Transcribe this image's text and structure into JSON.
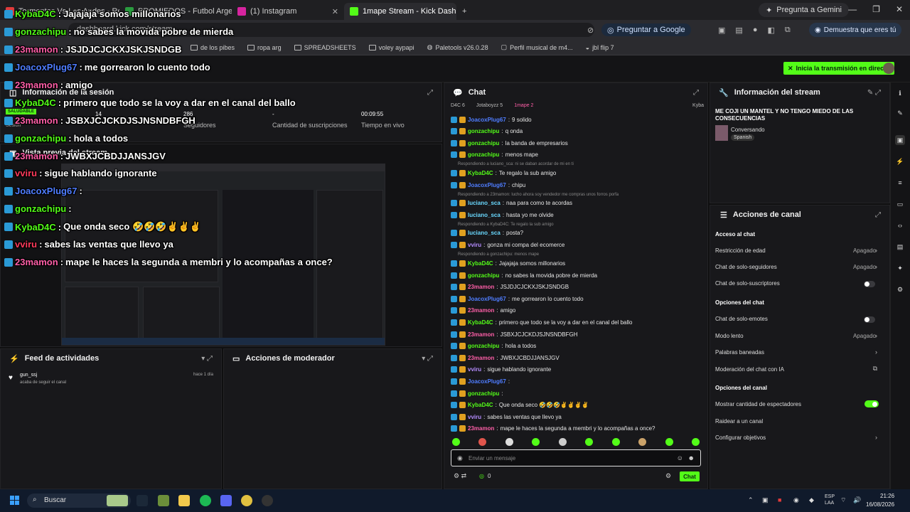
{
  "browser": {
    "tabs": [
      {
        "label": "Tormentas Vs Los Andes - Re...",
        "color": "#e23b3b"
      },
      {
        "label": "PROMIEDOS - Futbol Argentino",
        "color": "#2a9c3f"
      },
      {
        "label": "(1) Instagram",
        "color": "#d6249f"
      },
      {
        "label": "1mape Stream - Kick Dashboard",
        "color": "#53fc18"
      }
    ],
    "new_tab": "+",
    "gemini_label": "Pregunta a Gemini",
    "url": "dashboard.kick.com/stream",
    "google_btn": "Preguntar a Google",
    "proof_btn": "Demuestra que eres tú",
    "bookmarks": [
      "de los pibes",
      "ropa arg",
      "SPREADSHEETS",
      "voley aypapi",
      "Paletools v26.0.28",
      "Perfil musical de m4...",
      "jbl flip 7"
    ]
  },
  "dashboard": {
    "go_live": "Inicia la transmisión en directo",
    "session": {
      "title": "Información de la sesión",
      "tag": "SALUDABLE",
      "tag_sub": "Sesión",
      "stats": [
        {
          "value": "14",
          "label": ""
        },
        {
          "value": "286",
          "label": "Seguidores"
        },
        {
          "value": "-",
          "label": "Cantidad de suscripciones"
        },
        {
          "value": "00:09:55",
          "label": "Tiempo en vivo"
        }
      ]
    },
    "preview_title": "Vista previa del stream",
    "activity": {
      "title": "Feed de actividades",
      "user": "gun_ssj",
      "action": "acaba de seguir el canal",
      "time": "hace 1 día"
    },
    "moderator": {
      "title": "Acciones de moderador"
    },
    "chat": {
      "title": "Chat",
      "top_bar": [
        "D4C 6",
        "Jotaboyzz 5",
        "1mape 2",
        "Kyba"
      ],
      "messages": [
        {
          "user": "JoacoxPlug67",
          "text": "9 solido",
          "color": "#4f7dff"
        },
        {
          "user": "gonzachipu",
          "text": "q onda",
          "color": "#53fc18"
        },
        {
          "user": "gonzachipu",
          "text": "la banda de empresarios",
          "color": "#53fc18"
        },
        {
          "user": "gonzachipu",
          "text": "menos mape",
          "color": "#53fc18"
        },
        {
          "user": "KybaD4C",
          "text": "Te regalo la sub amigo",
          "color": "#53fc18",
          "reply": "Respondiendo a luciano_sca: ni se daban acordar de mi en ti"
        },
        {
          "user": "JoacoxPlug67",
          "text": "chipu",
          "color": "#4f7dff"
        },
        {
          "user": "luciano_sca",
          "text": "naa para como te acordas",
          "color": "#6ad9ff",
          "reply": "Respondiendo a 23mamon: lucho ahora soy vendedor me compras unos forros porfa"
        },
        {
          "user": "luciano_sca",
          "text": "hasta yo me olvide",
          "color": "#6ad9ff"
        },
        {
          "user": "luciano_sca",
          "text": "posta?",
          "color": "#6ad9ff",
          "reply": "Respondiendo a KybaD4C: Te regalo la sub amigo"
        },
        {
          "user": "vviru",
          "text": "gonza mi compa del ecomerce",
          "color": "#b58cff"
        },
        {
          "user": "KybaD4C",
          "text": "Jajajaja somos millonarios",
          "color": "#53fc18",
          "reply": "Respondiendo a gonzachipu: menos mape"
        },
        {
          "user": "gonzachipu",
          "text": "no sabes la movida pobre de mierda",
          "color": "#53fc18"
        },
        {
          "user": "23mamon",
          "text": "JSJDJCJCKXJSKJSNDGB",
          "color": "#ff5fa8"
        },
        {
          "user": "JoacoxPlug67",
          "text": "me gorrearon lo cuento todo",
          "color": "#4f7dff"
        },
        {
          "user": "23mamon",
          "text": "amigo",
          "color": "#ff5fa8"
        },
        {
          "user": "KybaD4C",
          "text": "primero que todo se la voy a dar en el canal del ballo",
          "color": "#53fc18"
        },
        {
          "user": "23mamon",
          "text": "JSBXJCJCKDJSJNSNDBFGH",
          "color": "#ff5fa8"
        },
        {
          "user": "gonzachipu",
          "text": "hola a todos",
          "color": "#53fc18"
        },
        {
          "user": "23mamon",
          "text": "JWBXJCBDJJANSJGV",
          "color": "#ff5fa8"
        },
        {
          "user": "vviru",
          "text": "sigue hablando ignorante",
          "color": "#b58cff"
        },
        {
          "user": "JoacoxPlug67",
          "text": "",
          "color": "#4f7dff"
        },
        {
          "user": "gonzachipu",
          "text": "",
          "color": "#53fc18"
        },
        {
          "user": "KybaD4C",
          "text": "Que onda seco 🤣🤣🤣✌✌✌✌",
          "color": "#53fc18"
        },
        {
          "user": "vviru",
          "text": "sabes las ventas que llevo ya",
          "color": "#b58cff"
        },
        {
          "user": "23mamon",
          "text": "mape le haces la segunda a membri y lo acompañas a once?",
          "color": "#ff5fa8"
        }
      ],
      "input_placeholder": "Enviar un mensaje",
      "points": "0",
      "send_label": "Chat"
    },
    "stream_info": {
      "title": "Información del stream",
      "stream_title": "ME COJI UN MANTEL Y NO TENGO MIEDO DE LAS CONSECUENCIAS",
      "category": "Conversando",
      "language": "Spanish"
    },
    "channel_actions": {
      "title": "Acciones de canal",
      "sections": [
        {
          "heading": "Acceso al chat",
          "items": [
            {
              "label": "Restricción de edad",
              "value": "Apagado",
              "kind": "chevron"
            },
            {
              "label": "Chat de solo-seguidores",
              "value": "Apagado",
              "kind": "chevron"
            },
            {
              "label": "Chat de solo-suscriptores",
              "value": "",
              "kind": "toggle-off"
            }
          ]
        },
        {
          "heading": "Opciones del chat",
          "items": [
            {
              "label": "Chat de solo-emotes",
              "value": "",
              "kind": "toggle-off"
            },
            {
              "label": "Modo lento",
              "value": "Apagado",
              "kind": "chevron"
            },
            {
              "label": "Palabras baneadas",
              "value": "",
              "kind": "chevron"
            },
            {
              "label": "Moderación del chat con IA",
              "value": "",
              "kind": "external"
            }
          ]
        },
        {
          "heading": "Opciones del canal",
          "items": [
            {
              "label": "Mostrar cantidad de espectadores",
              "value": "",
              "kind": "toggle-on"
            },
            {
              "label": "Raidear a un canal",
              "value": "",
              "kind": "none"
            },
            {
              "label": "Configurar objetivos",
              "value": "",
              "kind": "chevron"
            }
          ]
        }
      ]
    }
  },
  "overlay_chat": [
    {
      "user": "KybaD4C",
      "text": "Jajajaja somos millonarios",
      "color": "#53fc18"
    },
    {
      "user": "gonzachipu",
      "text": "no sabes la movida pobre de mierda",
      "color": "#53fc18"
    },
    {
      "user": "23mamon",
      "text": "JSJDJCJCKXJSKJSNDGB",
      "color": "#ff5fa8"
    },
    {
      "user": "JoacoxPlug67",
      "text": "me gorrearon lo cuento todo",
      "color": "#4f7dff"
    },
    {
      "user": "23mamon",
      "text": "amigo",
      "color": "#ff5fa8"
    },
    {
      "user": "KybaD4C",
      "text": "primero que todo se la voy a dar en el canal del ballo",
      "color": "#53fc18"
    },
    {
      "user": "23mamon",
      "text": "JSBXJCJCKDJSJNSNDBFGH",
      "color": "#ff5fa8"
    },
    {
      "user": "gonzachipu",
      "text": "hola a todos",
      "color": "#53fc18"
    },
    {
      "user": "23mamon",
      "text": "JWBXJCBDJJANSJGV",
      "color": "#ff5fa8"
    },
    {
      "user": "vviru",
      "text": "sigue hablando ignorante",
      "color": "#ff3b5c"
    },
    {
      "user": "JoacoxPlug67",
      "text": "",
      "color": "#4f7dff"
    },
    {
      "user": "gonzachipu",
      "text": "",
      "color": "#53fc18"
    },
    {
      "user": "KybaD4C",
      "text": "Que onda seco 🤣🤣🤣✌✌✌",
      "color": "#53fc18"
    },
    {
      "user": "vviru",
      "text": "sabes las ventas que llevo ya",
      "color": "#ff3b5c"
    },
    {
      "user": "23mamon",
      "text": "mape le haces la segunda a membri y lo acompañas a once?",
      "color": "#ff5fa8"
    }
  ],
  "taskbar": {
    "search": "Buscar",
    "lang": "ESP",
    "lang_sub": "LAA",
    "time": "21:26",
    "date": "16/08/2026"
  },
  "colors": {
    "accent": "#53fc18",
    "panel": "#18181b",
    "bg": "#0f0f10"
  }
}
